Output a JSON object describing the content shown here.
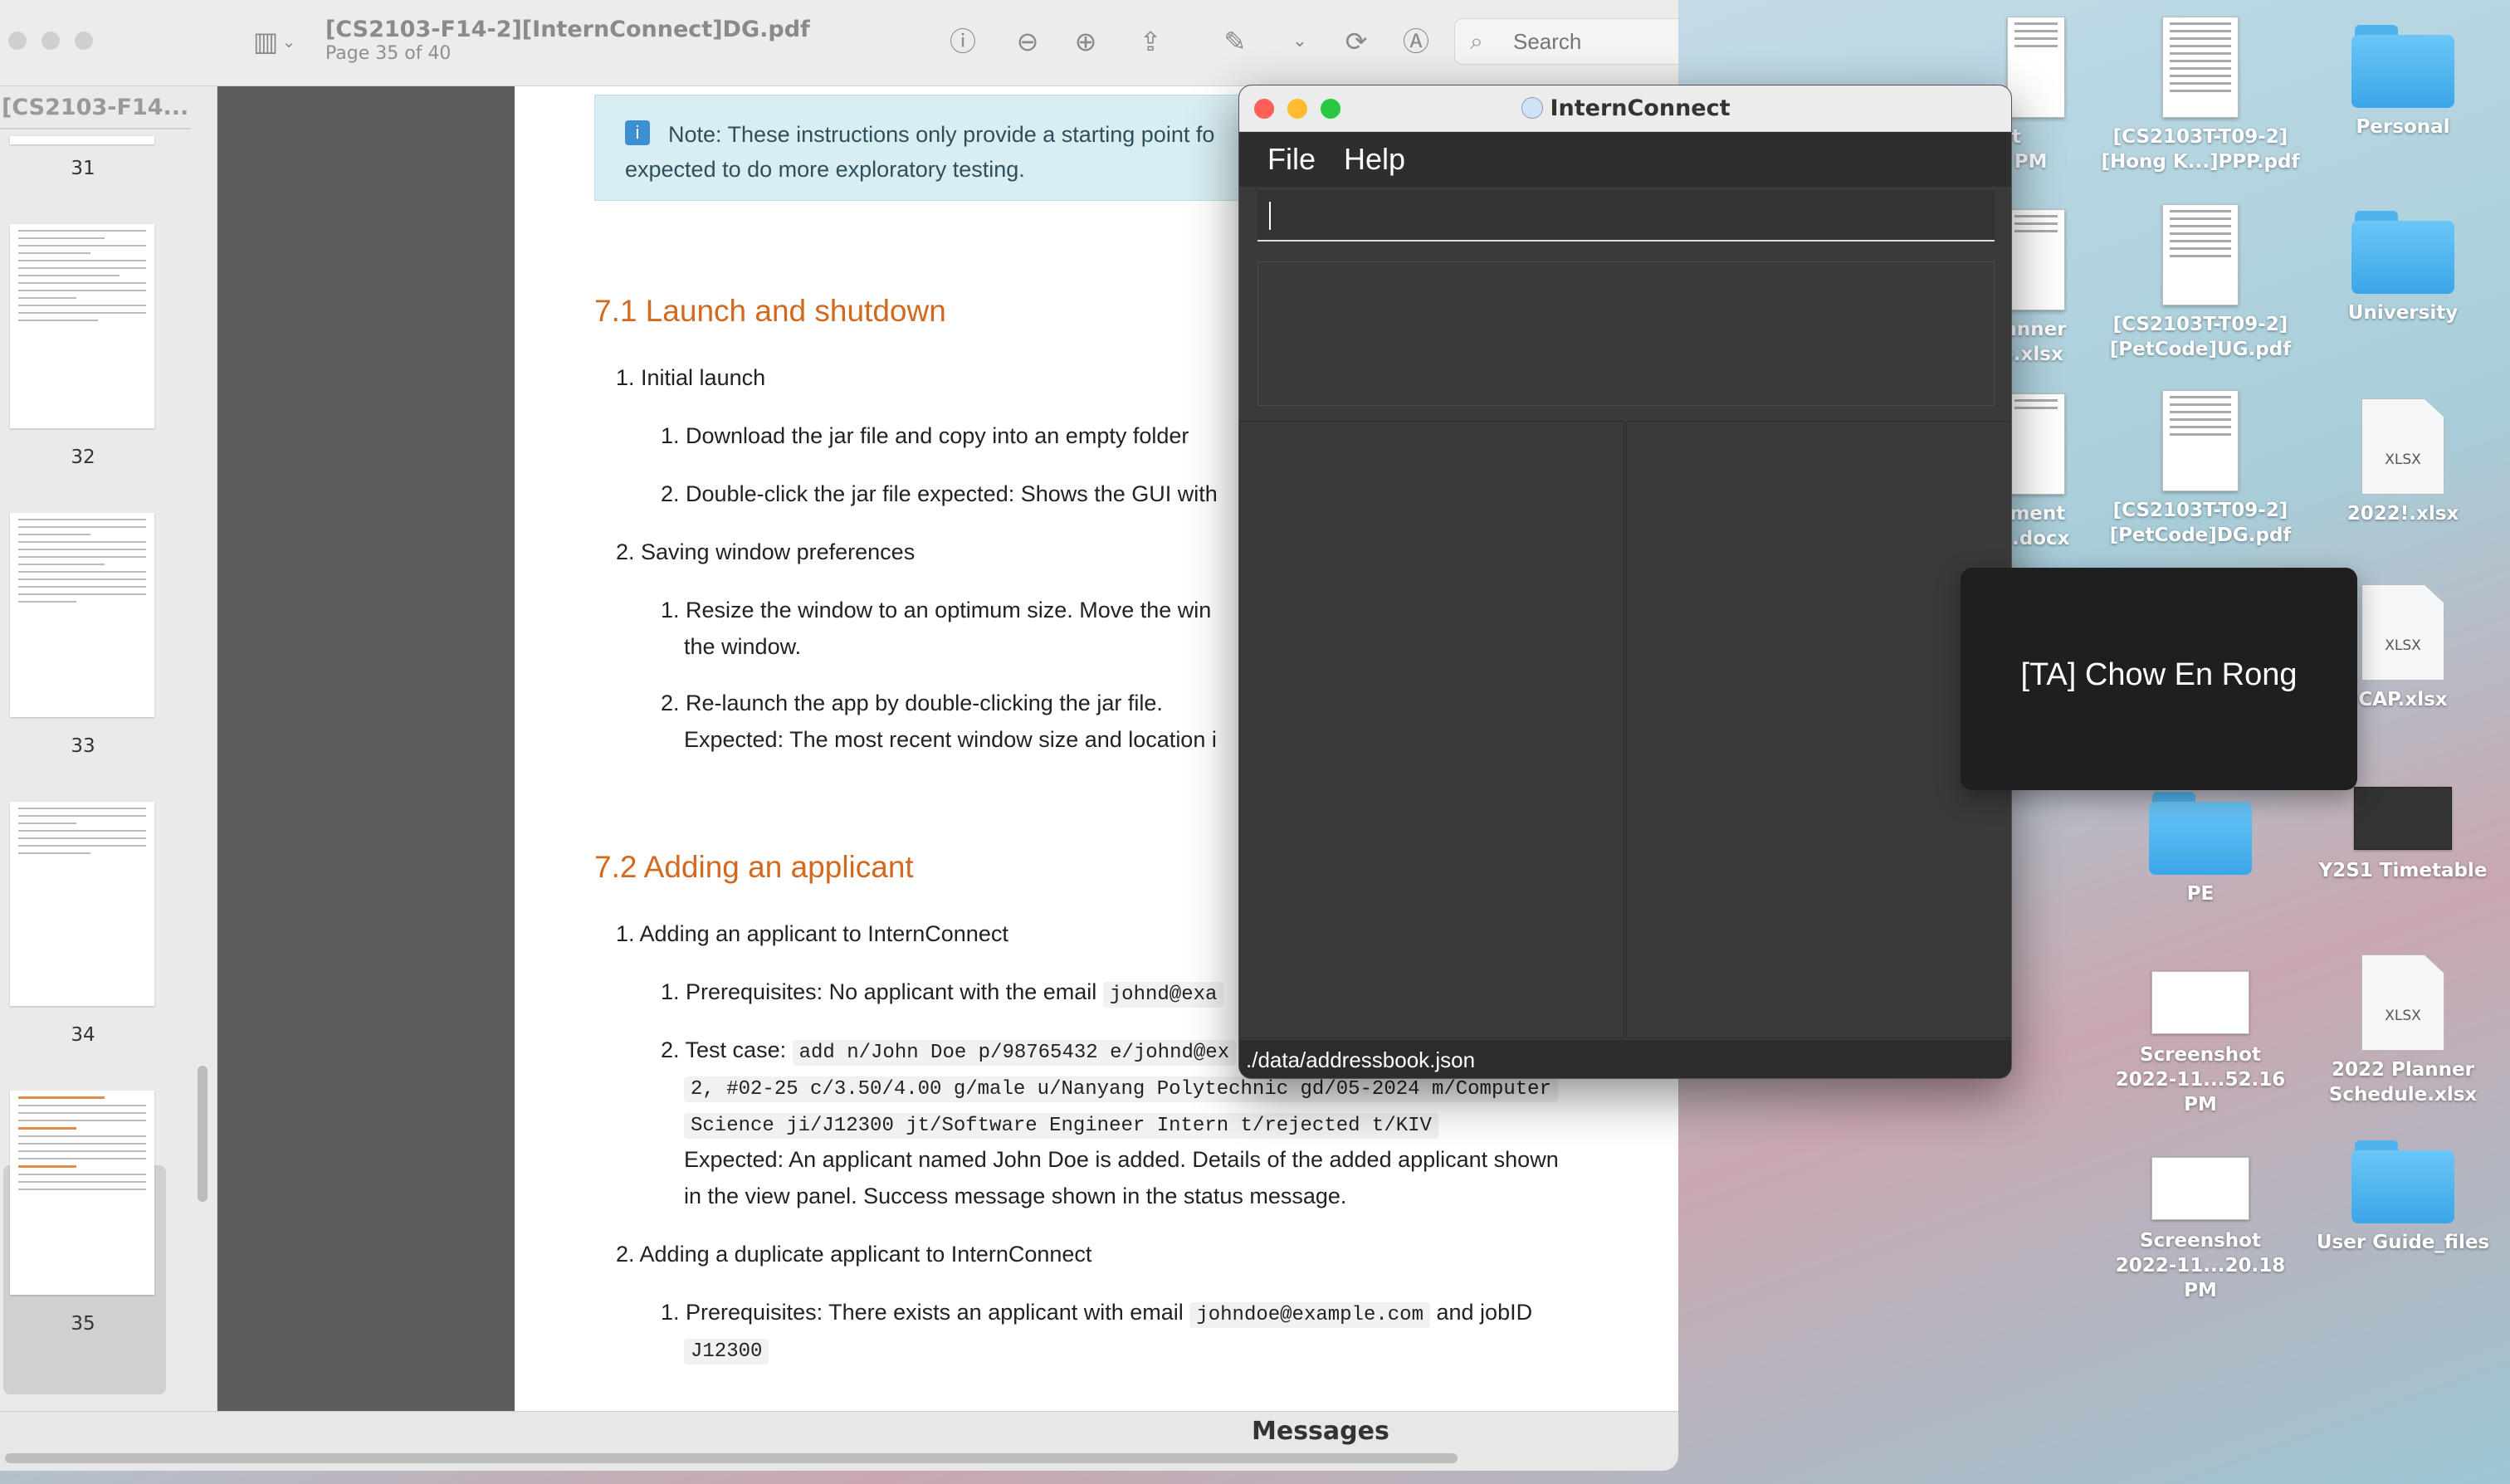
{
  "preview": {
    "title": "[CS2103-F14-2][InternConnect]DG.pdf",
    "subtitle": "Page 35 of 40",
    "search_placeholder": "Search",
    "sidebar_header": "[CS2103-F14...",
    "page_numbers": [
      "31",
      "32",
      "33",
      "34",
      "35"
    ],
    "selected_page": "35",
    "bottom_label": "Messages"
  },
  "document": {
    "note_text": "Note: These instructions only provide a starting point fo",
    "note_text2": "expected to do more exploratory testing.",
    "h_launch": "7.1 Launch and shutdown",
    "l1": "1. Initial launch",
    "l1a": "1. Download the jar file and copy into an empty folder",
    "l1b": "2. Double-click the jar file expected: Shows the GUI with",
    "l2": "2. Saving window preferences",
    "l2a": "1. Resize the window to an optimum size. Move the win",
    "l2a2": "the window.",
    "l2b": "2. Re-launch the app by double-clicking the jar file.",
    "l2b2": "Expected: The most recent window size and location i",
    "h_adding": "7.2 Adding an applicant",
    "a1": "1. Adding an applicant to InternConnect",
    "a1a": "1. Prerequisites: No applicant with the email",
    "a1a_code": "johnd@exa",
    "a1b": "2. Test case:",
    "a1b_code1": "add n/John Doe p/98765432 e/johnd@ex",
    "a1b_code2": "2, #02-25 c/3.50/4.00 g/male u/Nanyang Polytechnic gd/05-2024 m/Computer",
    "a1b_code3": "Science ji/J12300 jt/Software Engineer Intern t/rejected t/KIV",
    "a1b_exp1": "Expected: An applicant named John Doe is added. Details of the added applicant shown",
    "a1b_exp2": "in the view panel. Success message shown in the status message.",
    "a2": "2. Adding a duplicate applicant to InternConnect",
    "a2a": "1. Prerequisites: There exists an applicant with email",
    "a2a_code": "johndoe@example.com",
    "a2a_mid": "and jobID",
    "a2a_code2": "J12300"
  },
  "internconnect": {
    "title": "InternConnect",
    "menu_file": "File",
    "menu_help": "Help",
    "command_value": "",
    "status": "./data/addressbook.json"
  },
  "tooltip": {
    "text": "[TA] Chow En Rong"
  },
  "desktop": {
    "items": [
      {
        "label": "shot\n.28 PM",
        "kind": "partial"
      },
      {
        "label": "[CS2103T-T09-2]\n[Hong K...]PPP.pdf",
        "kind": "doc"
      },
      {
        "label": "Personal",
        "kind": "folder"
      },
      {
        "label": "lanner\ne.xlsx",
        "kind": "partial"
      },
      {
        "label": "[CS2103T-T09-2]\n[PetCode]UG.pdf",
        "kind": "doc"
      },
      {
        "label": "University",
        "kind": "folder"
      },
      {
        "label": "cment\nt).docx",
        "kind": "partial"
      },
      {
        "label": "[CS2103T-T09-2]\n[PetCode]DG.pdf",
        "kind": "doc"
      },
      {
        "label": "2022!.xlsx",
        "kind": "xlsx"
      },
      {
        "label": "CAP.xlsx",
        "kind": "xlsx"
      },
      {
        "label": "PE",
        "kind": "folder"
      },
      {
        "label": "Y2S1 Timetable",
        "kind": "shot"
      },
      {
        "label": "Screenshot\n2022-11...52.16 PM",
        "kind": "shot"
      },
      {
        "label": "2022 Planner\nSchedule.xlsx",
        "kind": "xlsx"
      },
      {
        "label": "Screenshot\n2022-11...20.18 PM",
        "kind": "shot"
      },
      {
        "label": "User Guide_files",
        "kind": "folder"
      }
    ],
    "xlsx_badge": "XLSX"
  },
  "colors": {
    "heading": "#d2691e",
    "ic_bg": "#3a3a3a",
    "note_bg": "#d8eef2"
  }
}
